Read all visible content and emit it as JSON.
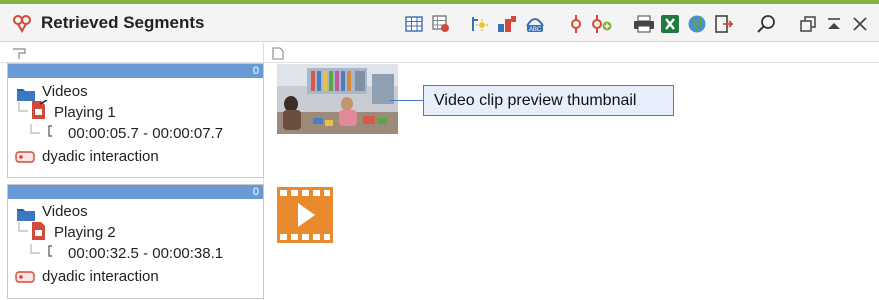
{
  "window": {
    "title": "Retrieved Segments"
  },
  "toolbar": {
    "icons": [
      "table-view-icon",
      "matrix-view-icon",
      "settings-magic-icon",
      "bar-chart-icon",
      "abc-text-icon",
      "activate-code-icon",
      "add-code-icon",
      "print-icon",
      "excel-export-icon",
      "globe-icon",
      "export-icon",
      "search-icon",
      "restore-icon",
      "minimize-icon",
      "close-icon"
    ]
  },
  "segments": [
    {
      "count": "0",
      "folder": "Videos",
      "document": "Playing 1",
      "timecode": "00:00:05.7 - 00:00:07.7",
      "code": "dyadic interaction"
    },
    {
      "count": "0",
      "folder": "Videos",
      "document": "Playing 2",
      "timecode": "00:00:32.5 - 00:00:38.1",
      "code": "dyadic interaction"
    }
  ],
  "preview": {
    "callout_label": "Video clip preview thumbnail"
  },
  "colors": {
    "accent_green": "#7fb33a",
    "card_header_blue": "#6a9ad6",
    "film_orange": "#ea8a2e",
    "code_red": "#d24a3a"
  }
}
